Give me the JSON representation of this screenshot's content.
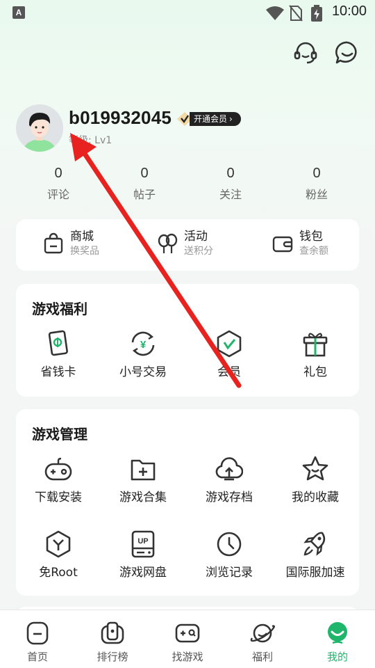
{
  "status_bar": {
    "a_icon": "A",
    "time": "10:00"
  },
  "profile": {
    "username": "b019932045",
    "vip_badge": "开通会员",
    "vip_chevron": "›",
    "level": "等级: Lv1"
  },
  "stats": [
    {
      "value": "0",
      "label": "评论"
    },
    {
      "value": "0",
      "label": "帖子"
    },
    {
      "value": "0",
      "label": "关注"
    },
    {
      "value": "0",
      "label": "粉丝"
    }
  ],
  "quick": [
    {
      "title": "商城",
      "sub": "换奖品",
      "icon": "shopping-bag-icon"
    },
    {
      "title": "活动",
      "sub": "送积分",
      "icon": "balloons-icon"
    },
    {
      "title": "钱包",
      "sub": "查余额",
      "icon": "wallet-icon"
    }
  ],
  "welfare": {
    "title": "游戏福利",
    "items": [
      {
        "label": "省钱卡",
        "icon": "savings-card-icon"
      },
      {
        "label": "小号交易",
        "icon": "yuan-exchange-icon"
      },
      {
        "label": "会员",
        "icon": "vip-shield-icon"
      },
      {
        "label": "礼包",
        "icon": "gift-icon"
      }
    ]
  },
  "manage": {
    "title": "游戏管理",
    "items": [
      {
        "label": "下载安装",
        "icon": "gamepad-icon"
      },
      {
        "label": "游戏合集",
        "icon": "folder-plus-icon"
      },
      {
        "label": "游戏存档",
        "icon": "cloud-upload-icon"
      },
      {
        "label": "我的收藏",
        "icon": "star-icon"
      },
      {
        "label": "免Root",
        "icon": "root-hex-icon"
      },
      {
        "label": "游戏网盘",
        "icon": "cloud-drive-icon"
      },
      {
        "label": "浏览记录",
        "icon": "clock-icon"
      },
      {
        "label": "国际服加速",
        "icon": "rocket-icon"
      }
    ]
  },
  "nav": [
    {
      "label": "首页",
      "icon": "home-icon"
    },
    {
      "label": "排行榜",
      "icon": "ranking-icon"
    },
    {
      "label": "找游戏",
      "icon": "find-game-icon"
    },
    {
      "label": "福利",
      "icon": "planet-icon"
    },
    {
      "label": "我的",
      "icon": "me-icon",
      "active": true
    }
  ],
  "colors": {
    "accent": "#1fb56a",
    "arrow": "#e8231f",
    "card": "#ffffff"
  }
}
